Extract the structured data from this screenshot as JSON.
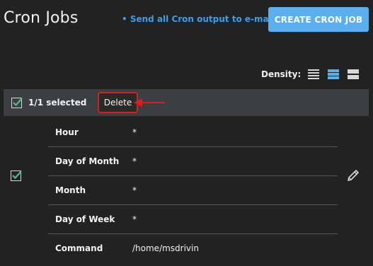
{
  "header": {
    "title": "Cron Jobs",
    "email_link": "• Send all Cron output to e-mail",
    "create_button": "CREATE CRON JOB"
  },
  "density": {
    "label": "Density:",
    "options": [
      "list-icon",
      "compact-icon",
      "comfortable-icon"
    ],
    "selected": "compact-icon"
  },
  "bulk": {
    "checked": true,
    "selected_text": "1/1 selected",
    "delete_label": "Delete"
  },
  "job": {
    "checked": true,
    "fields": [
      {
        "label": "Hour",
        "value": "*"
      },
      {
        "label": "Day of Month",
        "value": "*"
      },
      {
        "label": "Month",
        "value": "*"
      },
      {
        "label": "Day of Week",
        "value": "*"
      },
      {
        "label": "Command",
        "value": "/home/msdrivin"
      }
    ]
  },
  "colors": {
    "accent": "#5aafef",
    "link": "#3b9ee8",
    "check": "#49c18b",
    "highlight": "#d81e1e"
  }
}
